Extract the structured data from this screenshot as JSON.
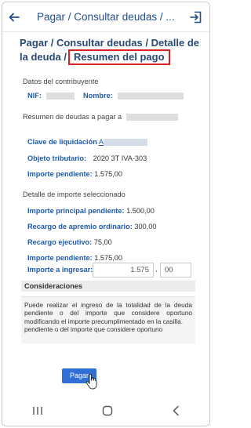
{
  "header": {
    "title": "Pagar / Consultar deudas / ...",
    "back_icon": "arrow-left-icon",
    "exit_icon": "logout-icon"
  },
  "breadcrumb": {
    "prefix": "Pagar / Consultar deudas / Detalle de la deuda /",
    "current": "Resumen del pago",
    "highlight_color": "#e02020"
  },
  "contributor": {
    "section_title": "Datos del contribuyente",
    "nif_label": "NIF:",
    "name_label": "Nombre:"
  },
  "summary": {
    "section_title": "Resumen de deudas a pagar a",
    "clave_label": "Clave de liquidación",
    "clave_value": "A",
    "objeto_label": "Objeto tributario:",
    "objeto_value": "2020 3T IVA-303",
    "importe_label": "Importe pendiente:",
    "importe_value": "1.575,00"
  },
  "detail": {
    "section_title": "Detalle de importe seleccionado",
    "principal_label": "Importe principal pendiente:",
    "principal_value": "1.500,00",
    "recargo_apremio_label": "Recargo de apremio ordinario:",
    "recargo_apremio_value": "300,00",
    "recargo_ejecutivo_label": "Recargo ejecutivo:",
    "recargo_ejecutivo_value": "75,00",
    "pendiente_label": "Importe pendiente:",
    "pendiente_value": "1.575,00"
  },
  "payment": {
    "amount_label": "Importe a ingresar:",
    "amount_integer": "1.575",
    "amount_separator": ",",
    "amount_decimal": "00"
  },
  "considerations": {
    "title": "Consideraciones",
    "text": "Puede realizar el ingreso de la totalidad de la deuda pendiente o del importe que considere oportuno modificando el importe precumplimentado en la casilla.",
    "text_cut": "pendiente o del importe que considere oportuno"
  },
  "actions": {
    "pay_label": "Pagar",
    "accent": "#2f6fd6"
  },
  "system_nav": {
    "recent_icon": "recent-apps-icon",
    "home_icon": "home-icon",
    "back_icon": "back-chevron-icon"
  }
}
